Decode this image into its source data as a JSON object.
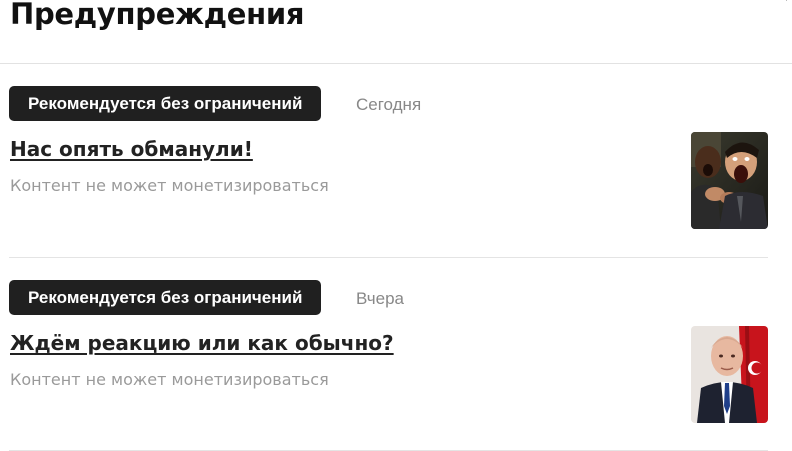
{
  "header": {
    "title": "Предупреждения"
  },
  "alerts": [
    {
      "badge": "Рекомендуется без ограничений",
      "date": "Сегодня",
      "title": "Нас опять обманули!",
      "description": "Контент не может монетизироваться",
      "thumbnail_icon": "shocked-men-photo"
    },
    {
      "badge": "Рекомендуется без ограничений",
      "date": "Вчера",
      "title": "Ждём реакцию или как обычно?",
      "description": "Контент не может монетизироваться",
      "thumbnail_icon": "man-in-suit-with-flag-photo"
    }
  ],
  "colors": {
    "badge_bg": "#202020",
    "badge_text": "#ffffff",
    "muted_text": "#9a9a9a",
    "divider": "#e4e4e4"
  }
}
